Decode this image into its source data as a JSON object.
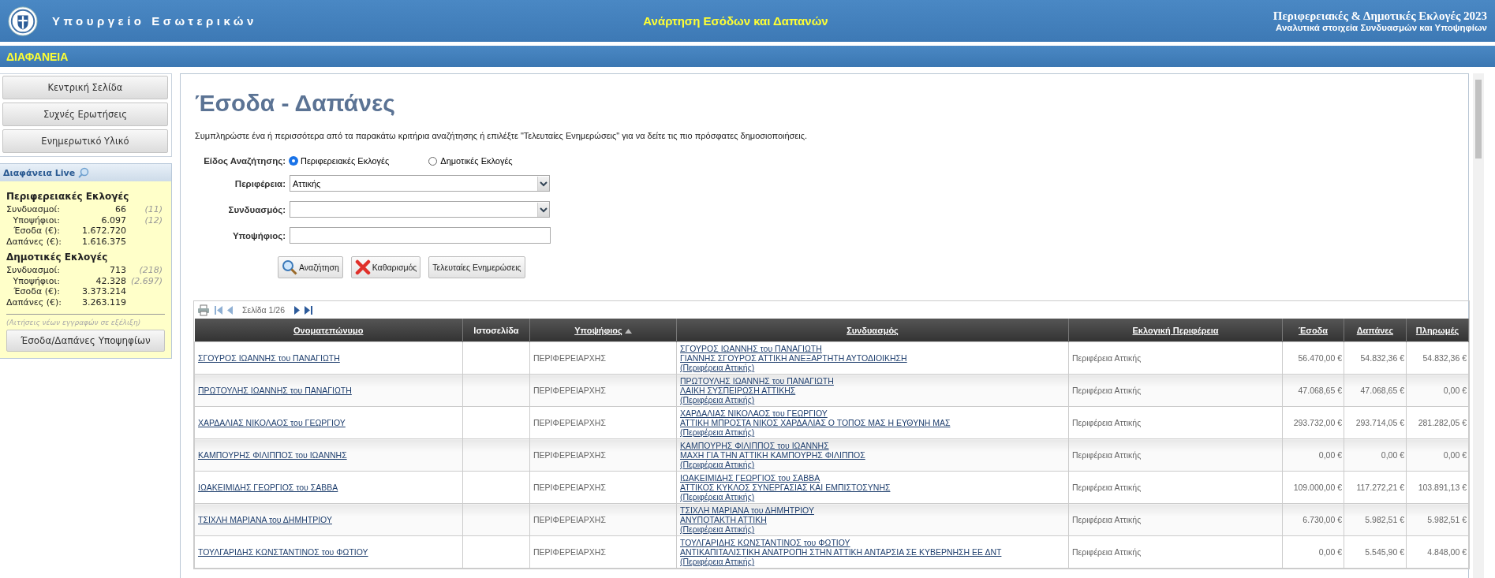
{
  "header": {
    "ministry": "Υπουργείο Εσωτερικών",
    "title": "Ανάρτηση Εσόδων και Δαπανών",
    "election": "Περιφερειακές & Δημοτικές Εκλογές 2023",
    "subtitle": "Αναλυτικά στοιχεία Συνδυασμών και Υποψηφίων"
  },
  "section_bar": "ΔΙΑΦΑΝΕΙΑ",
  "sidebar": {
    "nav": [
      "Κεντρική Σελίδα",
      "Συχνές Ερωτήσεις",
      "Ενημερωτικό Υλικό"
    ],
    "live": {
      "title": "Διαφάνεια Live",
      "groups": [
        {
          "heading": "Περιφερειακές Εκλογές",
          "rows": [
            {
              "label": "Συνδυασμοί:",
              "value": "66",
              "note": "(11)"
            },
            {
              "label": "Υποψήφιοι:",
              "value": "6.097",
              "note": "(12)"
            },
            {
              "label": "Έσοδα (€):",
              "value": "1.672.720"
            },
            {
              "label": "Δαπάνες (€):",
              "value": "1.616.375"
            }
          ]
        },
        {
          "heading": "Δημοτικές Εκλογές",
          "rows": [
            {
              "label": "Συνδυασμοί:",
              "value": "713",
              "note": "(218)"
            },
            {
              "label": "Υποψήφιοι:",
              "value": "42.328",
              "note": "(2.697)"
            },
            {
              "label": "Έσοδα (€):",
              "value": "3.373.214"
            },
            {
              "label": "Δαπάνες (€):",
              "value": "3.263.119"
            }
          ]
        }
      ],
      "footnote": "(Αιτήσεις νέων εγγραφών σε εξέλιξη)",
      "button": "Έσοδα/Δαπάνες Υποψηφίων"
    }
  },
  "page": {
    "title": "Έσοδα - Δαπάνες",
    "intro": "Συμπληρώστε ένα ή περισσότερα από τα παρακάτω κριτήρια αναζήτησης ή επιλέξτε \"Τελευταίες Ενημερώσεις\" για να δείτε τις πιο πρόσφατες δημοσιοποιήσεις.",
    "search_type": {
      "label": "Είδος Αναζήτησης:",
      "options": [
        {
          "label": "Περιφερειακές Εκλογές",
          "selected": true
        },
        {
          "label": "Δημοτικές Εκλογές",
          "selected": false
        }
      ]
    },
    "region": {
      "label": "Περιφέρεια:",
      "value": "Αττικής"
    },
    "coalition": {
      "label": "Συνδυασμός:"
    },
    "candidate": {
      "label": "Υποψήφιος:"
    },
    "buttons": [
      {
        "kind": "search",
        "label": "Αναζήτηση"
      },
      {
        "kind": "clear",
        "label": "Καθαρισμός"
      },
      {
        "kind": "plain",
        "label": "Τελευταίες Ενημερώσεις"
      }
    ]
  },
  "table": {
    "page_label": "Σελίδα 1/26",
    "columns": [
      {
        "label": "Ονοματεπώνυμο",
        "link": true
      },
      {
        "label": "Ιστοσελίδα",
        "link": false
      },
      {
        "label": "Υποψήφιος",
        "link": true,
        "sorted": true
      },
      {
        "label": "Συνδυασμός",
        "link": true
      },
      {
        "label": "Εκλογική Περιφέρεια",
        "link": true
      },
      {
        "label": "Έσοδα",
        "link": true
      },
      {
        "label": "Δαπάνες",
        "link": true
      },
      {
        "label": "Πληρωμές",
        "link": true
      }
    ],
    "rows": [
      {
        "name": "ΣΓΟΥΡΟΣ ΙΩΑΝΝΗΣ του ΠΑΝΑΓΙΩΤΗ",
        "role": "ΠΕΡΙΦΕΡΕΙΑΡΧΗΣ",
        "coalition": [
          "ΣΓΟΥΡΟΣ ΙΩΑΝΝΗΣ του ΠΑΝΑΓΙΩΤΗ",
          "ΓΙΑΝΝΗΣ ΣΓΟΥΡΟΣ ΑΤΤΙΚΗ ΑΝΕΞΑΡΤΗΤΗ ΑΥΤΟΔΙΟΙΚΗΣΗ",
          "(Περιφέρεια Αττικής)"
        ],
        "region": "Περιφέρεια Αττικής",
        "income": "56.470,00 €",
        "expenses": "54.832,36 €",
        "payments": "54.832,36 €"
      },
      {
        "name": "ΠΡΩΤΟΥΛΗΣ ΙΩΑΝΝΗΣ του ΠΑΝΑΓΙΩΤΗ",
        "role": "ΠΕΡΙΦΕΡΕΙΑΡΧΗΣ",
        "coalition": [
          "ΠΡΩΤΟΥΛΗΣ ΙΩΑΝΝΗΣ του ΠΑΝΑΓΙΩΤΗ",
          "ΛΑΙΚΗ ΣΥΣΠΕΙΡΩΣΗ ΑΤΤΙΚΗΣ",
          "(Περιφέρεια Αττικής)"
        ],
        "region": "Περιφέρεια Αττικής",
        "income": "47.068,65 €",
        "expenses": "47.068,65 €",
        "payments": "0,00 €"
      },
      {
        "name": "ΧΑΡΔΑΛΙΑΣ ΝΙΚΟΛΑΟΣ του ΓΕΩΡΓΙΟΥ",
        "role": "ΠΕΡΙΦΕΡΕΙΑΡΧΗΣ",
        "coalition": [
          "ΧΑΡΔΑΛΙΑΣ ΝΙΚΟΛΑΟΣ του ΓΕΩΡΓΙΟΥ",
          "ΑΤΤΙΚΗ ΜΠΡΟΣΤΑ ΝΙΚΟΣ ΧΑΡΔΑΛΙΑΣ Ο ΤΟΠΟΣ ΜΑΣ Η ΕΥΘΥΝΗ ΜΑΣ",
          "(Περιφέρεια Αττικής)"
        ],
        "region": "Περιφέρεια Αττικής",
        "income": "293.732,00 €",
        "expenses": "293.714,05 €",
        "payments": "281.282,05 €"
      },
      {
        "name": "ΚΑΜΠΟΥΡΗΣ ΦΙΛΙΠΠΟΣ του ΙΩΑΝΝΗΣ",
        "role": "ΠΕΡΙΦΕΡΕΙΑΡΧΗΣ",
        "coalition": [
          "ΚΑΜΠΟΥΡΗΣ ΦΙΛΙΠΠΟΣ του ΙΩΑΝΝΗΣ",
          "ΜΑΧΗ ΓΙΑ ΤΗΝ ΑΤΤΙΚΗ ΚΑΜΠΟΥΡΗΣ ΦΙΛΙΠΠΟΣ",
          "(Περιφέρεια Αττικής)"
        ],
        "region": "Περιφέρεια Αττικής",
        "income": "0,00 €",
        "expenses": "0,00 €",
        "payments": "0,00 €"
      },
      {
        "name": "ΙΩΑΚΕΙΜΙΔΗΣ ΓΕΩΡΓΙΟΣ του ΣΑΒΒΑ",
        "role": "ΠΕΡΙΦΕΡΕΙΑΡΧΗΣ",
        "coalition": [
          "ΙΩΑΚΕΙΜΙΔΗΣ ΓΕΩΡΓΙΟΣ του ΣΑΒΒΑ",
          "ΑΤΤΙΚΟΣ ΚΥΚΛΟΣ ΣΥΝΕΡΓΑΣΙΑΣ ΚΑΙ ΕΜΠΙΣΤΟΣΥΝΗΣ",
          "(Περιφέρεια Αττικής)"
        ],
        "region": "Περιφέρεια Αττικής",
        "income": "109.000,00 €",
        "expenses": "117.272,21 €",
        "payments": "103.891,13 €"
      },
      {
        "name": "ΤΣΙΧΛΗ ΜΑΡΙΑΝΑ του ΔΗΜΗΤΡΙΟΥ",
        "role": "ΠΕΡΙΦΕΡΕΙΑΡΧΗΣ",
        "coalition": [
          "ΤΣΙΧΛΗ ΜΑΡΙΑΝΑ του ΔΗΜΗΤΡΙΟΥ",
          "ΑΝΥΠΟΤΑΚΤΗ ΑΤΤΙΚΗ",
          "(Περιφέρεια Αττικής)"
        ],
        "region": "Περιφέρεια Αττικής",
        "income": "6.730,00 €",
        "expenses": "5.982,51 €",
        "payments": "5.982,51 €"
      },
      {
        "name": "ΤΟΥΛΓΑΡΙΔΗΣ ΚΩΝΣΤΑΝΤΙΝΟΣ του ΦΩΤΙΟΥ",
        "role": "ΠΕΡΙΦΕΡΕΙΑΡΧΗΣ",
        "coalition": [
          "ΤΟΥΛΓΑΡΙΔΗΣ ΚΩΝΣΤΑΝΤΙΝΟΣ του ΦΩΤΙΟΥ",
          "ΑΝΤΙΚΑΠΙΤΑΛΙΣΤΙΚΗ ΑΝΑΤΡΟΠΗ ΣΤΗΝ ΑΤΤΙΚΗ ΑΝΤΑΡΣΙΑ ΣΕ ΚΥΒΕΡΝΗΣΗ ΕΕ ΔΝΤ",
          "(Περιφέρεια Αττικής)"
        ],
        "region": "Περιφέρεια Αττικής",
        "income": "0,00 €",
        "expenses": "5.545,90 €",
        "payments": "4.848,00 €"
      }
    ]
  }
}
